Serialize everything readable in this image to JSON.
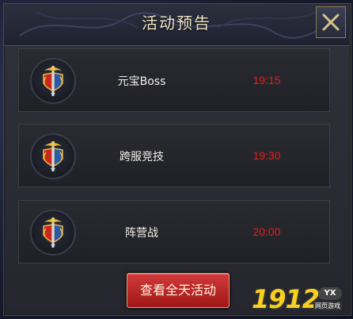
{
  "dialog": {
    "title": "活动预告",
    "close_icon": "close-x-icon"
  },
  "events": [
    {
      "name": "元宝Boss",
      "time": "19:15",
      "icon": "sword-shield-emblem-icon"
    },
    {
      "name": "跨服竞技",
      "time": "19:30",
      "icon": "sword-shield-emblem-icon"
    },
    {
      "name": "阵营战",
      "time": "20:00",
      "icon": "sword-shield-emblem-icon"
    }
  ],
  "footer": {
    "button_label": "查看全天活动"
  },
  "watermark": {
    "digits": "1912",
    "badge": "YX",
    "caption": "网页游戏"
  },
  "colors": {
    "time_text": "#e0201a",
    "button_bg": "#b82020",
    "title_text": "#f0e6c8"
  }
}
